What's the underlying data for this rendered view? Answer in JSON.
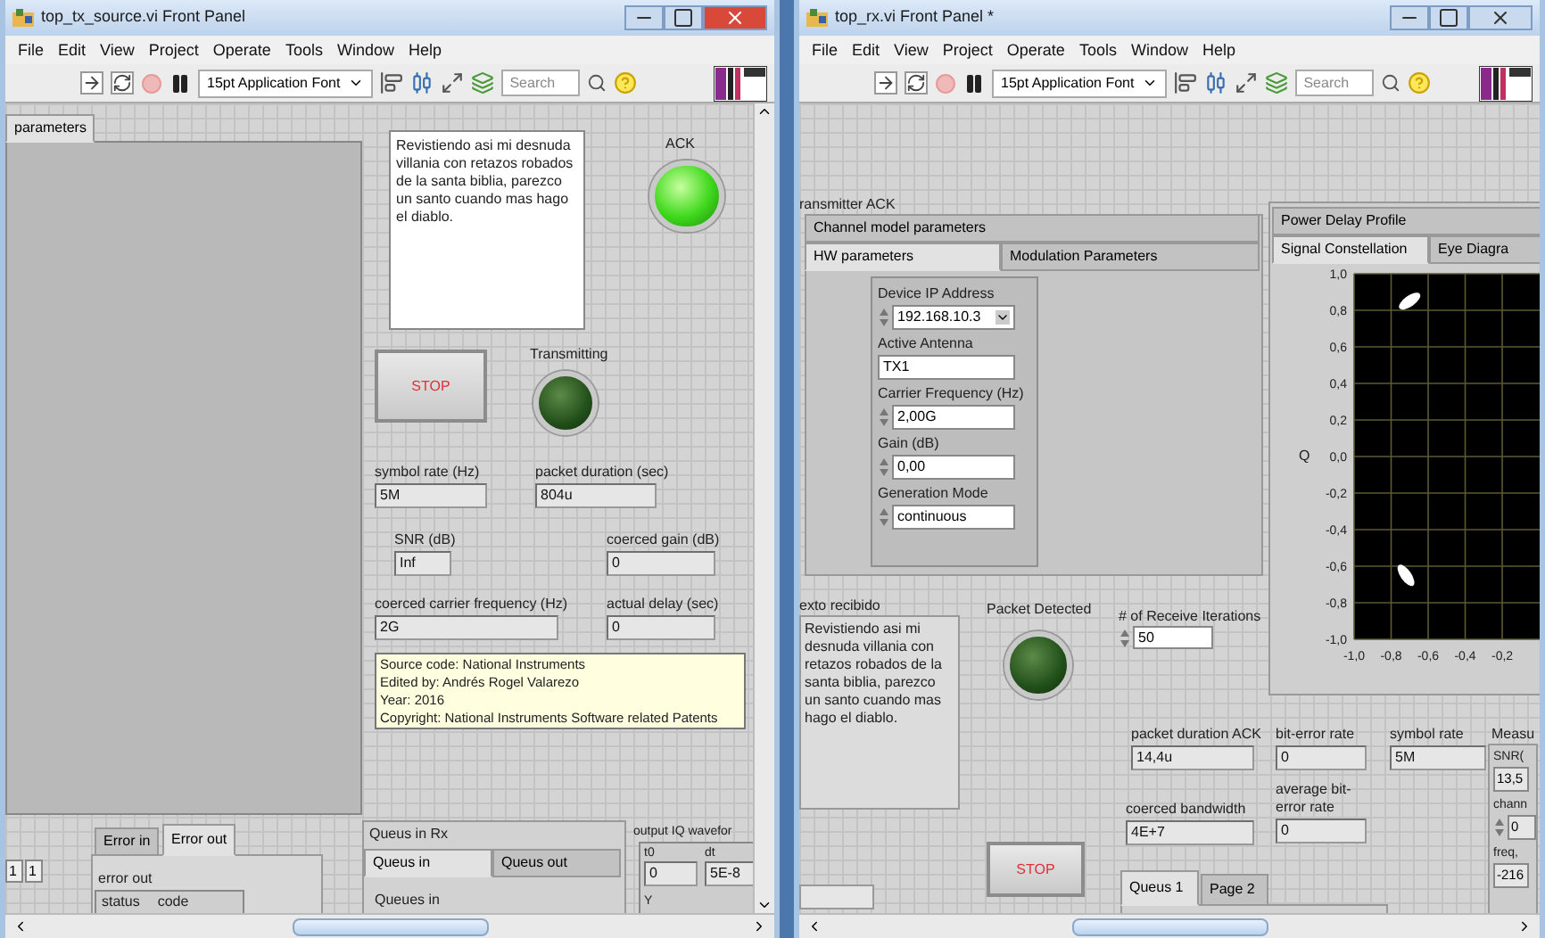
{
  "tx_window": {
    "title": "top_tx_source.vi Front Panel",
    "menu": [
      "File",
      "Edit",
      "View",
      "Project",
      "Operate",
      "Tools",
      "Window",
      "Help"
    ],
    "toolbar": {
      "font": "15pt Application Font",
      "search": {
        "placeholder": "Search"
      }
    },
    "panel": {
      "tab": {
        "label": "parameters",
        "selected": true
      },
      "message": "Revistiendo asi mi desnuda villania con retazos robados de la santa biblia, parezco un santo cuando mas hago el diablo.",
      "ack": {
        "label": "ACK",
        "on": true
      },
      "transmitting": {
        "label": "Transmitting",
        "on": false
      },
      "stop": "STOP",
      "indicators": [
        {
          "label": "symbol rate (Hz)",
          "value": "5M"
        },
        {
          "label": "packet duration (sec)",
          "value": "804u"
        },
        {
          "label": "SNR (dB)",
          "value": "Inf"
        },
        {
          "label": "coerced gain (dB)",
          "value": "0"
        },
        {
          "label": "coerced carrier frequency (Hz)",
          "value": "2G"
        },
        {
          "label": "actual delay (sec)",
          "value": "0"
        }
      ],
      "note": [
        "Source code:  National Instruments",
        "Edited by:  Andrés Rogel Valarezo",
        "Year:  2016",
        "Copyright:  National Instruments Software related Patents"
      ],
      "array_index": [
        "1",
        "1"
      ],
      "error_tabs": [
        {
          "label": "Error in",
          "selected": false
        },
        {
          "label": "Error out",
          "selected": true
        }
      ],
      "error_cluster": {
        "label": "error out",
        "columns": [
          "status",
          "code"
        ]
      },
      "queues": {
        "label": "Queus in Rx",
        "tabs": [
          {
            "label": "Queus in",
            "selected": true
          },
          {
            "label": "Queus out",
            "selected": false
          }
        ],
        "content": "Queues in"
      },
      "output": {
        "label": "output IQ wavefor",
        "fields": [
          {
            "label": "t0",
            "value": "0"
          },
          {
            "label": "dt",
            "value": "5E-8"
          }
        ],
        "y_label": "Y"
      }
    }
  },
  "rx_window": {
    "title": "top_rx.vi Front Panel *",
    "menu": [
      "File",
      "Edit",
      "View",
      "Project",
      "Operate",
      "Tools",
      "Window",
      "Help"
    ],
    "toolbar": {
      "font": "15pt Application Font",
      "search": {
        "placeholder": "Search"
      }
    },
    "panel": {
      "ack_label": "ransmitter ACK",
      "tabs": [
        {
          "label": "Channel model parameters",
          "selected": false
        },
        {
          "label": "HW parameters",
          "selected": true
        },
        {
          "label": "Modulation Parameters",
          "selected": false
        }
      ],
      "hw_fields": [
        {
          "label": "Device IP Address",
          "value": "192.168.10.3",
          "kind": "dropdown"
        },
        {
          "label": "Active Antenna",
          "value": "TX1",
          "kind": "text"
        },
        {
          "label": "Carrier Frequency (Hz)",
          "value": "2,00G",
          "kind": "numeric"
        },
        {
          "label": "Gain (dB)",
          "value": "0,00",
          "kind": "numeric"
        },
        {
          "label": "Generation Mode",
          "value": "continuous",
          "kind": "numeric"
        }
      ],
      "received": {
        "label": "exto recibido",
        "text": "Revistiendo asi mi desnuda villania con retazos robados de la santa biblia, parezco un santo cuando mas hago el diablo."
      },
      "packet_detected": {
        "label": "Packet Detected",
        "on": false
      },
      "iterations": {
        "label": "# of Receive Iterations",
        "value": "50"
      },
      "graph": {
        "tabs": [
          {
            "label": "Power Delay Profile",
            "selected": false
          },
          {
            "label": "Signal Constellation",
            "selected": true
          },
          {
            "label": "Eye Diagra",
            "selected": false
          }
        ],
        "chart_data": {
          "type": "scatter",
          "ylabel": "Q",
          "x": [
            -0.7,
            -0.72
          ],
          "series": [
            {
              "color": "#ffffff",
              "values": [
                0.85,
                -0.65
              ]
            }
          ],
          "xlim": [
            -1,
            0.06
          ],
          "ylim": [
            -1,
            1
          ],
          "grid": true,
          "xticks": [
            {
              "value": -1,
              "label": "-1,0"
            },
            {
              "value": -0.8,
              "label": "-0,8"
            },
            {
              "value": -0.6,
              "label": "-0,6"
            },
            {
              "value": -0.4,
              "label": "-0,4"
            },
            {
              "value": -0.2,
              "label": "-0,2"
            }
          ],
          "yticks": [
            {
              "value": 1,
              "label": "1,0"
            },
            {
              "value": 0.8,
              "label": "0,8"
            },
            {
              "value": 0.6,
              "label": "0,6"
            },
            {
              "value": 0.4,
              "label": "0,4"
            },
            {
              "value": 0.2,
              "label": "0,2"
            },
            {
              "value": 0,
              "label": "0,0"
            },
            {
              "value": -0.2,
              "label": "-0,2"
            },
            {
              "value": -0.4,
              "label": "-0,4"
            },
            {
              "value": -0.6,
              "label": "-0,6"
            },
            {
              "value": -0.8,
              "label": "-0,8"
            },
            {
              "value": -1,
              "label": "-1,0"
            }
          ]
        }
      },
      "indicators": [
        {
          "label": "packet duration ACK",
          "value": "14,4u"
        },
        {
          "label": "bit-error rate",
          "value": "0"
        },
        {
          "label": "symbol rate",
          "value": "5M"
        },
        {
          "label": "coerced bandwidth",
          "value": "4E+7"
        },
        {
          "label": "average bit-error rate",
          "value": "0"
        }
      ],
      "measurements": {
        "label": "Measu",
        "fields": [
          {
            "label": "SNR(",
            "value": "13,5",
            "kind": "text"
          },
          {
            "label": "chann",
            "value": "0",
            "kind": "numeric"
          },
          {
            "label": "freq, ",
            "value": "-216",
            "kind": "text"
          }
        ]
      },
      "stop": "STOP",
      "queue_tabs": [
        {
          "label": "Queus 1",
          "selected": true
        },
        {
          "label": "Page 2",
          "selected": false
        }
      ]
    }
  }
}
